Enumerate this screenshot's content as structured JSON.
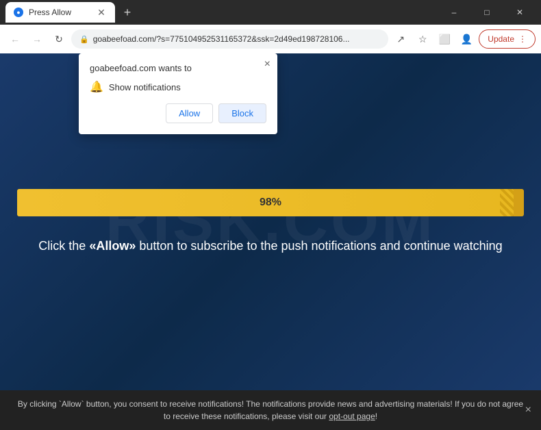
{
  "browser": {
    "tab": {
      "title": "Press Allow",
      "favicon": "●"
    },
    "address": "goabeefoad.com/?s=775104952531165372&ssk=2d49ed198728106...",
    "update_label": "Update",
    "window_controls": {
      "minimize": "–",
      "maximize": "□",
      "close": "✕"
    },
    "nav": {
      "back": "←",
      "forward": "→",
      "refresh": "↻"
    }
  },
  "notification_popup": {
    "title": "goabeefoad.com wants to",
    "permission_text": "Show notifications",
    "allow_label": "Allow",
    "block_label": "Block",
    "close": "×"
  },
  "main_content": {
    "progress_percent": "98%",
    "progress_value": 98,
    "message": "Click the «Allow» button to subscribe to the push notifications and continue watching",
    "watermark": "risk.com"
  },
  "bottom_banner": {
    "text": "By clicking `Allow` button, you consent to receive notifications! The notifications provide news and advertising materials! If you do not agree to receive these notifications, please visit our ",
    "link_text": "opt-out page",
    "text_end": "!",
    "close": "×"
  }
}
